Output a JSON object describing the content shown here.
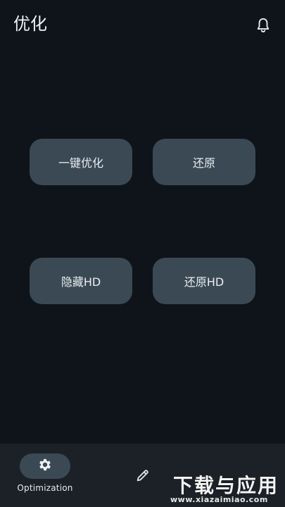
{
  "header": {
    "title": "优化"
  },
  "buttons": {
    "one_click_optimize": "一键优化",
    "restore": "还原",
    "hide_hd": "隐藏HD",
    "restore_hd": "还原HD"
  },
  "nav": {
    "optimization_label": "Optimization"
  },
  "watermark": {
    "main": "下载与应用",
    "url": "www.xiazaimiao.com"
  },
  "icons": {
    "bell": "bell-icon",
    "gear": "gear-icon",
    "edit": "pencil-icon"
  },
  "colors": {
    "background": "#0f141a",
    "button": "#3b4954",
    "navbar": "#1b2127"
  }
}
